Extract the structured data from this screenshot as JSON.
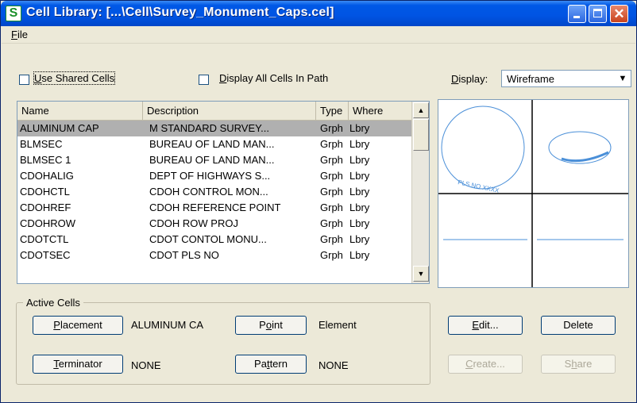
{
  "window": {
    "title": "Cell Library: [...\\Cell\\Survey_Monument_Caps.cel]",
    "minimize_glyph": "_",
    "maximize_glyph": "□",
    "close_glyph": "✕"
  },
  "menu": {
    "file": {
      "mnemonic": "F",
      "rest": "ile"
    }
  },
  "options": {
    "use_shared": {
      "mnemonic": "U",
      "rest": "se Shared Cells",
      "checked": false
    },
    "display_all": {
      "mnemonic": "D",
      "rest": "isplay All Cells In Path",
      "checked": false
    },
    "display_label": {
      "mnemonic": "D",
      "rest": "isplay:"
    },
    "display_value": "Wireframe"
  },
  "list": {
    "columns": [
      "Name",
      "Description",
      "Type",
      "Where"
    ],
    "rows": [
      {
        "name": "ALUMINUM CAP",
        "description": "M STANDARD SURVEY...",
        "type": "Grph",
        "where": "Lbry",
        "selected": true
      },
      {
        "name": "BLMSEC",
        "description": "BUREAU OF LAND MAN...",
        "type": "Grph",
        "where": "Lbry"
      },
      {
        "name": "BLMSEC 1",
        "description": "BUREAU OF LAND MAN...",
        "type": "Grph",
        "where": "Lbry"
      },
      {
        "name": "CDOHALIG",
        "description": "DEPT OF HIGHWAYS S...",
        "type": "Grph",
        "where": "Lbry"
      },
      {
        "name": "CDOHCTL",
        "description": "CDOH CONTROL MON...",
        "type": "Grph",
        "where": "Lbry"
      },
      {
        "name": "CDOHREF",
        "description": "CDOH REFERENCE POINT",
        "type": "Grph",
        "where": "Lbry"
      },
      {
        "name": "CDOHROW",
        "description": "CDOH ROW PROJ",
        "type": "Grph",
        "where": "Lbry"
      },
      {
        "name": "CDOTCTL",
        "description": "CDOT CONTOL MONU...",
        "type": "Grph",
        "where": "Lbry"
      },
      {
        "name": "CDOTSEC",
        "description": "CDOT PLS NO",
        "type": "Grph",
        "where": "Lbry"
      }
    ]
  },
  "preview": {
    "accent_color": "#4a8fd8",
    "top_left_text": "PLS NO XXXX"
  },
  "active_cells": {
    "title": "Active Cells",
    "placement": {
      "mnemonic": "P",
      "rest": "lacement",
      "value": "ALUMINUM CA"
    },
    "point": {
      "pre": "P",
      "mnemonic": "o",
      "rest": "int",
      "value": "Element"
    },
    "terminator": {
      "mnemonic": "T",
      "rest": "erminator",
      "value": "NONE"
    },
    "pattern": {
      "pre": "Pa",
      "mnemonic": "t",
      "rest": "tern",
      "value": "NONE"
    }
  },
  "actions": {
    "edit": {
      "mnemonic": "E",
      "rest": "dit..."
    },
    "delete": {
      "label": "Delete"
    },
    "create": {
      "mnemonic": "C",
      "rest": "reate..."
    },
    "share": {
      "pre": "S",
      "mnemonic": "h",
      "rest": "are"
    }
  }
}
